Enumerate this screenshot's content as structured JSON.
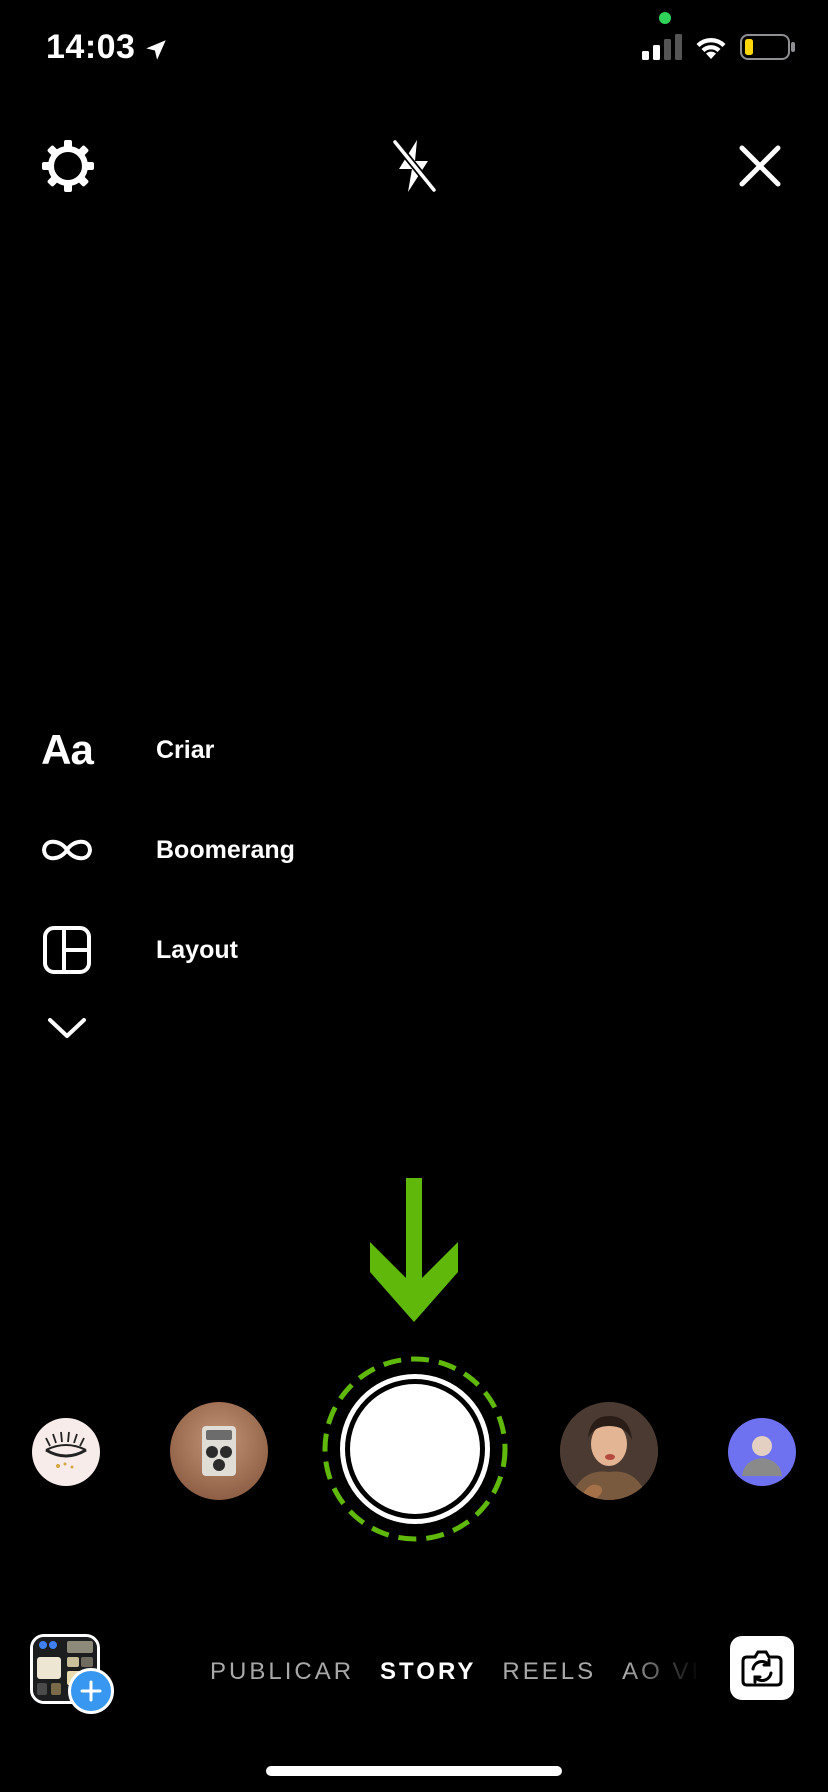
{
  "status_bar": {
    "time": "14:03",
    "battery_color": "#ffd60a",
    "mic_indicator_color": "#30d158"
  },
  "top_controls": {
    "settings_icon": "gear-icon",
    "flash_icon": "flash-off-icon",
    "close_icon": "close-icon"
  },
  "side_menu": {
    "items": [
      {
        "label": "Criar",
        "icon": "aa-text-icon",
        "glyph": "Aa"
      },
      {
        "label": "Boomerang",
        "icon": "infinity-icon"
      },
      {
        "label": "Layout",
        "icon": "layout-grid-icon"
      }
    ],
    "expand_icon": "chevron-down-icon"
  },
  "annotation": {
    "arrow_color": "#5fb80a",
    "ring_color": "#5fb80a"
  },
  "carousel": {
    "effects": [
      {
        "name": "eyelash-effect"
      },
      {
        "name": "retro-camera-effect"
      },
      {
        "name": "shutter"
      },
      {
        "name": "portrait-effect"
      },
      {
        "name": "avatar-effect"
      }
    ]
  },
  "bottom_bar": {
    "modes": [
      "PUBLICAR",
      "STORY",
      "REELS",
      "AO VIVO"
    ],
    "active_mode": "STORY",
    "accent_color": "#3897f0"
  }
}
